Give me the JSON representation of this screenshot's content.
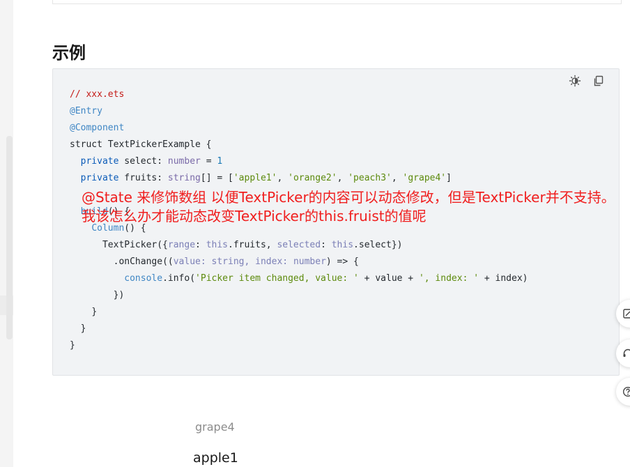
{
  "section": {
    "title": "示例"
  },
  "code": {
    "lines": {
      "l1": "// xxx.ets",
      "l2": "@Entry",
      "l3": "@Component",
      "l4_kw": "struct",
      "l4_rest": " TextPickerExample {",
      "l5_kw": "private",
      "l5_name": " select: ",
      "l5_type": "number",
      "l5_eq": " = ",
      "l5_num": "1",
      "l6_kw": "private",
      "l6_name": " fruits: ",
      "l6_type": "string",
      "l6_mid": "[] = [",
      "s1": "'apple1'",
      "s2": "'orange2'",
      "s3": "'peach3'",
      "s4": "'grape4'",
      "comma": ", ",
      "l6_end": "]",
      "l8_fn": "build",
      "l8_rest": "() {",
      "l9_fn": "Column",
      "l9_rest": "() {",
      "l10_a": "TextPicker({",
      "l10_range": "range",
      "l10_b": ": ",
      "l10_this1": "this",
      "l10_c": ".fruits, ",
      "l10_selected": "selected",
      "l10_d": ": ",
      "l10_this2": "this",
      "l10_e": ".select})",
      "l11_a": ".onChange((",
      "l11_value": "value",
      "l11_b": ": ",
      "l11_t1": "string",
      "l11_c": ", ",
      "l11_index": "index",
      "l11_d": ": ",
      "l11_t2": "number",
      "l11_e": ") => {",
      "l12_console": "console",
      "l12_a": ".info(",
      "l12_s1": "'Picker item changed, value: '",
      "l12_b": " + value + ",
      "l12_s2": "', index: '",
      "l12_c": " + index)",
      "l13": "})",
      "close": "}"
    }
  },
  "overlay_text": "@State 来修饰数组 以便TextPicker的内容可以动态修改，但是TextPicker并不支持。我该怎么办才能动态改变TextPicker的this.fruist的值呢",
  "picker": {
    "prev": "grape4",
    "current": "apple1"
  },
  "icons": {
    "theme": "sun-icon",
    "copy": "copy-icon",
    "feedback": "edit-icon",
    "support": "headset-icon",
    "help": "help-icon"
  }
}
